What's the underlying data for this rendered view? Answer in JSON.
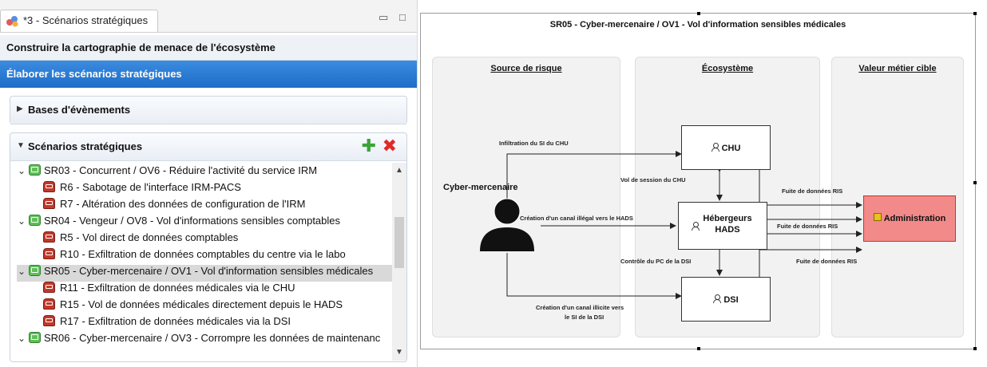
{
  "tab": {
    "title": "*3 - Scénarios stratégiques",
    "icon": "scenario-app-icon"
  },
  "window_controls": {
    "minimize": "▭",
    "maximize": "□"
  },
  "steps": {
    "build": "Construire la cartographie de menace de l'écosystème",
    "elaborate": "Élaborer les scénarios stratégiques"
  },
  "sections": {
    "events": {
      "label": "Bases d'évènements"
    },
    "scenarios": {
      "label": "Scénarios stratégiques"
    }
  },
  "tree": [
    {
      "id": "SR03",
      "label": "SR03 - Concurrent / OV6 - Réduire l'activité du service IRM",
      "level": 0
    },
    {
      "label": "R6 - Sabotage de l'interface IRM-PACS",
      "level": 1
    },
    {
      "label": "R7 - Altération des données de configuration de l'IRM",
      "level": 1
    },
    {
      "id": "SR04",
      "label": "SR04 - Vengeur / OV8 - Vol d'informations sensibles comptables",
      "level": 0
    },
    {
      "label": "R5 - Vol direct de données comptables",
      "level": 1
    },
    {
      "label": "R10 - Exfiltration de données comptables du centre via le labo",
      "level": 1
    },
    {
      "id": "SR05",
      "label": "SR05 - Cyber-mercenaire / OV1 - Vol d'information sensibles médicales",
      "level": 0,
      "selected": true
    },
    {
      "label": "R11 - Exfiltration de données médicales via le CHU",
      "level": 1
    },
    {
      "label": "R15 - Vol de données médicales directement depuis le HADS",
      "level": 1
    },
    {
      "label": "R17 - Exfiltration de données médicales via la DSI",
      "level": 1
    },
    {
      "id": "SR06",
      "label": "SR06 - Cyber-mercenaire / OV3 - Corrompre les données de maintenanc",
      "level": 0
    }
  ],
  "diagram": {
    "title": "SR05 - Cyber-mercenaire / OV1 - Vol d'information sensibles médicales",
    "lanes": [
      "Source de risque",
      "Écosystème",
      "Valeur métier cible"
    ],
    "actor": "Cyber-mercenaire",
    "nodes": {
      "chu": "CHU",
      "hads_line1": "Hébergeurs",
      "hads_line2": "HADS",
      "dsi": "DSI",
      "admin": "Administration"
    },
    "edges": {
      "infiltration": "Infiltration du SI du CHU",
      "session": "Vol de session du CHU",
      "canal_hads": "Création d'un canal illégal vers le HADS",
      "controle": "Contrôle du PC de la DSI",
      "canal_dsi_1": "Création d'un canal illicite vers",
      "canal_dsi_2": "le SI de la DSI",
      "ris1": "Fuite de données RIS",
      "ris2": "Fuite de données RIS",
      "ris3": "Fuite de données RIS"
    },
    "colors": {
      "admin_fill": "#f28a8a",
      "admin_border": "#c0392b",
      "lane_bg": "#f2f2f2"
    }
  }
}
